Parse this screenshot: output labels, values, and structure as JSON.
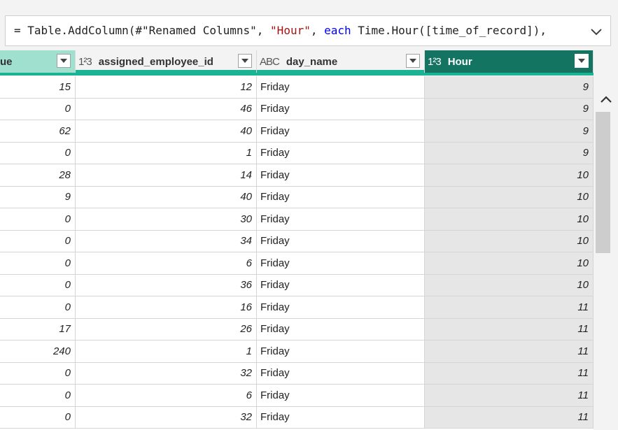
{
  "formula": {
    "prefix": "= Table.AddColumn(#\"Renamed Columns\", ",
    "string_arg": "\"Hour\"",
    "sep": ", ",
    "keyword": "each",
    "suffix": " Time.Hour([time_of_record]),"
  },
  "columns": [
    {
      "label": "ue",
      "type_icon": "",
      "selected": false
    },
    {
      "label": "assigned_employee_id",
      "type_icon": "1²3",
      "selected": false
    },
    {
      "label": "day_name",
      "type_icon": "ABC",
      "selected": false
    },
    {
      "label": "Hour",
      "type_icon": "1²3",
      "selected": true
    }
  ],
  "rows": [
    [
      "15",
      "12",
      "Friday",
      "9"
    ],
    [
      "0",
      "46",
      "Friday",
      "9"
    ],
    [
      "62",
      "40",
      "Friday",
      "9"
    ],
    [
      "0",
      "1",
      "Friday",
      "9"
    ],
    [
      "28",
      "14",
      "Friday",
      "10"
    ],
    [
      "9",
      "40",
      "Friday",
      "10"
    ],
    [
      "0",
      "30",
      "Friday",
      "10"
    ],
    [
      "0",
      "34",
      "Friday",
      "10"
    ],
    [
      "0",
      "6",
      "Friday",
      "10"
    ],
    [
      "0",
      "36",
      "Friday",
      "10"
    ],
    [
      "0",
      "16",
      "Friday",
      "11"
    ],
    [
      "17",
      "26",
      "Friday",
      "11"
    ],
    [
      "240",
      "1",
      "Friday",
      "11"
    ],
    [
      "0",
      "32",
      "Friday",
      "11"
    ],
    [
      "0",
      "6",
      "Friday",
      "11"
    ],
    [
      "0",
      "32",
      "Friday",
      "11"
    ]
  ],
  "colors": {
    "accent": "#1ab394",
    "selected_header": "#137461",
    "keyword": "#0000ff",
    "string": "#a31515"
  }
}
